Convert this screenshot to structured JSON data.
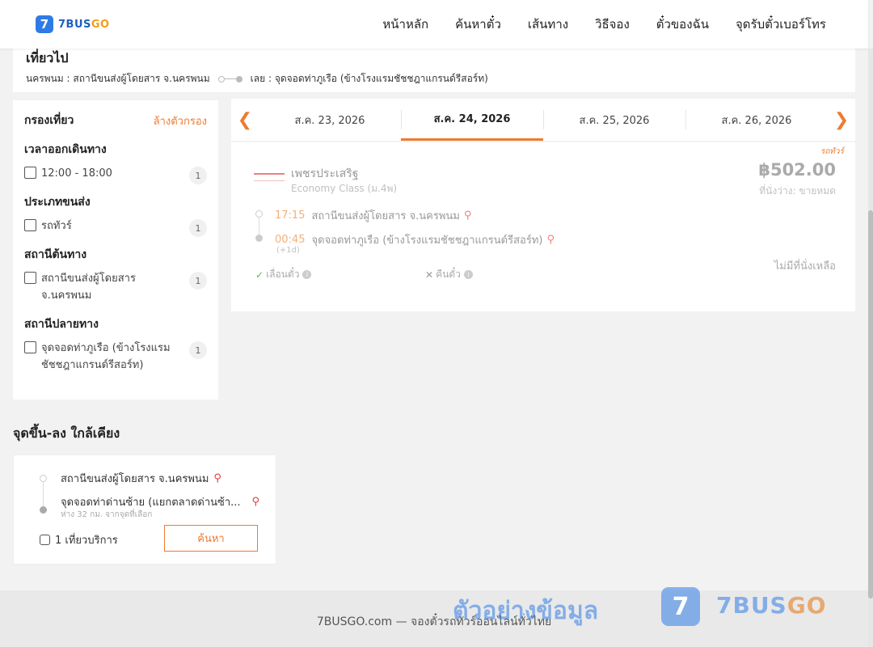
{
  "brand": {
    "logo_mark": "7",
    "name_main": "7BUS",
    "name_accent": "GO"
  },
  "nav": {
    "items": [
      "หน้าหลัก",
      "ค้นหาตั๋ว",
      "เส้นทาง",
      "วิธีจอง",
      "ตั๋วของฉัน",
      "จุดรับตั๋วเบอร์โทร"
    ]
  },
  "trip": {
    "title": "เที่ยวไป",
    "origin": "นครพนม : สถานีขนส่งผู้โดยสาร จ.นครพนม",
    "destination": "เลย : จุดจอดท่าภูเรือ (ข้างโรงแรมชัชชฎาแกรนด์รีสอร์ท)"
  },
  "filter": {
    "title": "กรองเที่ยว",
    "clear_label": "ล้างตัวกรอง",
    "groups": [
      {
        "title": "เวลาออกเดินทาง",
        "option": "12:00 - 18:00",
        "count": "1"
      },
      {
        "title": "ประเภทขนส่ง",
        "option": "รถทัวร์",
        "count": "1"
      },
      {
        "title": "สถานีต้นทาง",
        "option": "สถานีขนส่งผู้โดยสาร จ.นครพนม",
        "count": "1"
      },
      {
        "title": "สถานีปลายทาง",
        "option": "จุดจอดท่าภูเรือ (ข้างโรงแรมชัชชฎาแกรนด์รีสอร์ท)",
        "count": "1"
      }
    ]
  },
  "dates": {
    "prev_icon": "chevron-left-icon",
    "next_icon": "chevron-right-icon",
    "tabs": [
      "ส.ค. 23, 2026",
      "ส.ค. 24, 2026",
      "ส.ค. 25, 2026",
      "ส.ค. 26, 2026"
    ],
    "active_index": 1
  },
  "result": {
    "tag": "รถทัวร์",
    "operator": "เพชรประเสริฐ",
    "class": "Economy Class (ม.4พ)",
    "price": "฿502.00",
    "seat_status": "ที่นั่งว่าง: ขายหมด",
    "depart_time": "17:15",
    "depart_place": "สถานีขนส่งผู้โดยสาร จ.นครพนม",
    "arrive_time": "00:45",
    "arrive_place": "จุดจอดท่าภูเรือ (ข้างโรงแรมชัชชฎาแกรนด์รีสอร์ท)",
    "plus_day": "(+1d)",
    "sold_out": "ไม่มีที่นั่งเหลือ",
    "reschedule": "เลื่อนตั๋ว",
    "refund": "คืนตั๋ว"
  },
  "nearby": {
    "title": "จุดขึ้น-ลง ใกล้เคียง",
    "origin": "สถานีขนส่งผู้โดยสาร จ.นครพนม",
    "destination": "จุดจอดท่าด่านซ้าย (แยกตลาดด่านซ้า...",
    "distance": "ห่าง 32 กม. จากจุดที่เลือก",
    "service": "1 เที่ยวบริการ",
    "search_label": "ค้นหา"
  },
  "footer": {
    "text": "7BUSGO.com — จองตั๋วรถทัวร์ออนไลน์ทั่วไทย"
  },
  "watermark": {
    "text": "ตัวอย่างข้อมูล",
    "mark": "7",
    "brand_main": "7BUS",
    "brand_accent": "GO"
  },
  "colors": {
    "accent": "#ee7a2f",
    "brand": "#2f7be5"
  }
}
